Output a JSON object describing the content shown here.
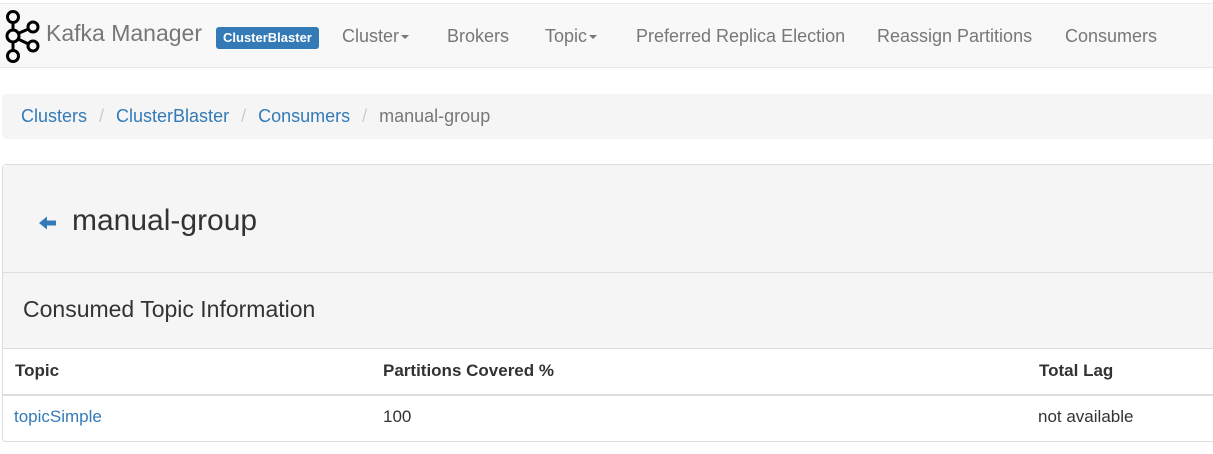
{
  "navbar": {
    "brand": "Kafka Manager",
    "cluster_badge": "ClusterBlaster",
    "items": {
      "cluster": "Cluster",
      "brokers": "Brokers",
      "topic": "Topic",
      "preferred_replica_election": "Preferred Replica Election",
      "reassign_partitions": "Reassign Partitions",
      "consumers": "Consumers"
    }
  },
  "breadcrumb": {
    "items": [
      "Clusters",
      "ClusterBlaster",
      "Consumers"
    ],
    "active": "manual-group"
  },
  "group": {
    "title": "manual-group"
  },
  "consumed_topics": {
    "heading": "Consumed Topic Information",
    "columns": [
      "Topic",
      "Partitions Covered %",
      "Total Lag"
    ],
    "rows": [
      {
        "topic": "topicSimple",
        "partitions_covered": "100",
        "total_lag": "not available"
      }
    ]
  },
  "colors": {
    "link": "#337ab7",
    "navbar_bg": "#f8f8f8",
    "panel_bg": "#f5f5f5"
  }
}
